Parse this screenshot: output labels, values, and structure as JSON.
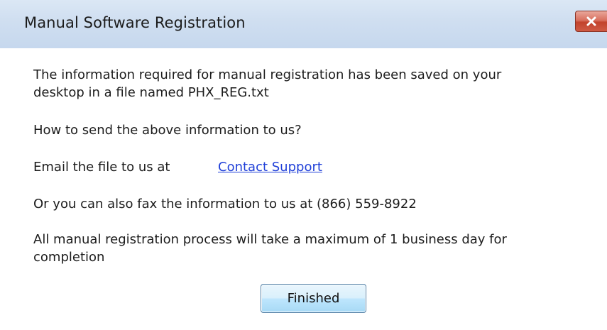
{
  "window": {
    "title": "Manual Software Registration",
    "close_icon": "close-icon"
  },
  "message": {
    "line1": "The information required for manual registration has been saved on your",
    "line2": "desktop in a file named PHX_REG.txt",
    "question": "How to send the above information to us?",
    "email_prefix": "Email the file  to us at",
    "email_link": "Contact Support",
    "fax": "Or you can also fax the information  to us at (866) 559-8922",
    "note_line1": "All manual registration process will take a maximum of 1 business day for",
    "note_line2": "completion"
  },
  "buttons": {
    "finished": "Finished"
  },
  "colors": {
    "title_bar": "#cfdef0",
    "close_button": "#c94a34",
    "link": "#1f3fd8",
    "button_border": "#4f7fa6"
  }
}
